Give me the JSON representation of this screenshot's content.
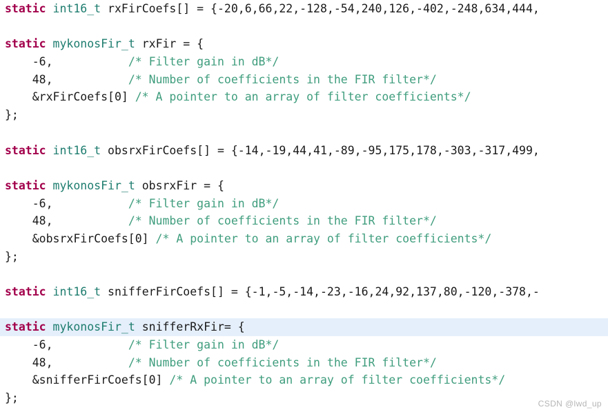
{
  "editor": {
    "language": "C",
    "background_color": "#ffffff",
    "highlight_color": "#e5effb",
    "keyword_color": "#a2004b",
    "type_color": "#1d7c6e",
    "comment_color": "#3f9d7d",
    "text_color": "#1a1a1a"
  },
  "watermark": {
    "text": "CSDN @lwd_up"
  },
  "lines": [
    {
      "id": "line-1",
      "highlighted": false,
      "tokens": [
        {
          "kind": "keyword",
          "text": "static"
        },
        {
          "kind": "plain",
          "text": " "
        },
        {
          "kind": "type",
          "text": "int16_t"
        },
        {
          "kind": "plain",
          "text": " rxFirCoefs[] = {-20,6,66,22,-128,-54,240,126,-402,-248,634,444,"
        }
      ]
    },
    {
      "id": "line-2",
      "highlighted": false,
      "tokens": []
    },
    {
      "id": "line-3",
      "highlighted": false,
      "tokens": [
        {
          "kind": "keyword",
          "text": "static"
        },
        {
          "kind": "plain",
          "text": " "
        },
        {
          "kind": "type",
          "text": "mykonosFir_t"
        },
        {
          "kind": "plain",
          "text": " rxFir = {"
        }
      ]
    },
    {
      "id": "line-4",
      "highlighted": false,
      "tokens": [
        {
          "kind": "plain",
          "text": "    -6,           "
        },
        {
          "kind": "comment",
          "text": "/* Filter gain in dB*/"
        }
      ]
    },
    {
      "id": "line-5",
      "highlighted": false,
      "tokens": [
        {
          "kind": "plain",
          "text": "    48,           "
        },
        {
          "kind": "comment",
          "text": "/* Number of coefficients in the FIR filter*/"
        }
      ]
    },
    {
      "id": "line-6",
      "highlighted": false,
      "tokens": [
        {
          "kind": "plain",
          "text": "    &rxFirCoefs[0] "
        },
        {
          "kind": "comment",
          "text": "/* A pointer to an array of filter coefficients*/"
        }
      ]
    },
    {
      "id": "line-7",
      "highlighted": false,
      "tokens": [
        {
          "kind": "plain",
          "text": "};"
        }
      ]
    },
    {
      "id": "line-8",
      "highlighted": false,
      "tokens": []
    },
    {
      "id": "line-9",
      "highlighted": false,
      "tokens": [
        {
          "kind": "keyword",
          "text": "static"
        },
        {
          "kind": "plain",
          "text": " "
        },
        {
          "kind": "type",
          "text": "int16_t"
        },
        {
          "kind": "plain",
          "text": " obsrxFirCoefs[] = {-14,-19,44,41,-89,-95,175,178,-303,-317,499,"
        }
      ]
    },
    {
      "id": "line-10",
      "highlighted": false,
      "tokens": []
    },
    {
      "id": "line-11",
      "highlighted": false,
      "tokens": [
        {
          "kind": "keyword",
          "text": "static"
        },
        {
          "kind": "plain",
          "text": " "
        },
        {
          "kind": "type",
          "text": "mykonosFir_t"
        },
        {
          "kind": "plain",
          "text": " obsrxFir = {"
        }
      ]
    },
    {
      "id": "line-12",
      "highlighted": false,
      "tokens": [
        {
          "kind": "plain",
          "text": "    -6,           "
        },
        {
          "kind": "comment",
          "text": "/* Filter gain in dB*/"
        }
      ]
    },
    {
      "id": "line-13",
      "highlighted": false,
      "tokens": [
        {
          "kind": "plain",
          "text": "    48,           "
        },
        {
          "kind": "comment",
          "text": "/* Number of coefficients in the FIR filter*/"
        }
      ]
    },
    {
      "id": "line-14",
      "highlighted": false,
      "tokens": [
        {
          "kind": "plain",
          "text": "    &obsrxFirCoefs[0] "
        },
        {
          "kind": "comment",
          "text": "/* A pointer to an array of filter coefficients*/"
        }
      ]
    },
    {
      "id": "line-15",
      "highlighted": false,
      "tokens": [
        {
          "kind": "plain",
          "text": "};"
        }
      ]
    },
    {
      "id": "line-16",
      "highlighted": false,
      "tokens": []
    },
    {
      "id": "line-17",
      "highlighted": false,
      "tokens": [
        {
          "kind": "keyword",
          "text": "static"
        },
        {
          "kind": "plain",
          "text": " "
        },
        {
          "kind": "type",
          "text": "int16_t"
        },
        {
          "kind": "plain",
          "text": " snifferFirCoefs[] = {-1,-5,-14,-23,-16,24,92,137,80,-120,-378,-"
        }
      ]
    },
    {
      "id": "line-18",
      "highlighted": false,
      "tokens": []
    },
    {
      "id": "line-19",
      "highlighted": true,
      "tokens": [
        {
          "kind": "keyword",
          "text": "static"
        },
        {
          "kind": "plain",
          "text": " "
        },
        {
          "kind": "type",
          "text": "mykonosFir_t"
        },
        {
          "kind": "plain",
          "text": " snifferRxFir= {"
        }
      ]
    },
    {
      "id": "line-20",
      "highlighted": false,
      "tokens": [
        {
          "kind": "plain",
          "text": "    -6,           "
        },
        {
          "kind": "comment",
          "text": "/* Filter gain in dB*/"
        }
      ]
    },
    {
      "id": "line-21",
      "highlighted": false,
      "tokens": [
        {
          "kind": "plain",
          "text": "    48,           "
        },
        {
          "kind": "comment",
          "text": "/* Number of coefficients in the FIR filter*/"
        }
      ]
    },
    {
      "id": "line-22",
      "highlighted": false,
      "tokens": [
        {
          "kind": "plain",
          "text": "    &snifferFirCoefs[0] "
        },
        {
          "kind": "comment",
          "text": "/* A pointer to an array of filter coefficients*/"
        }
      ]
    },
    {
      "id": "line-23",
      "highlighted": false,
      "tokens": [
        {
          "kind": "plain",
          "text": "};"
        }
      ]
    }
  ]
}
